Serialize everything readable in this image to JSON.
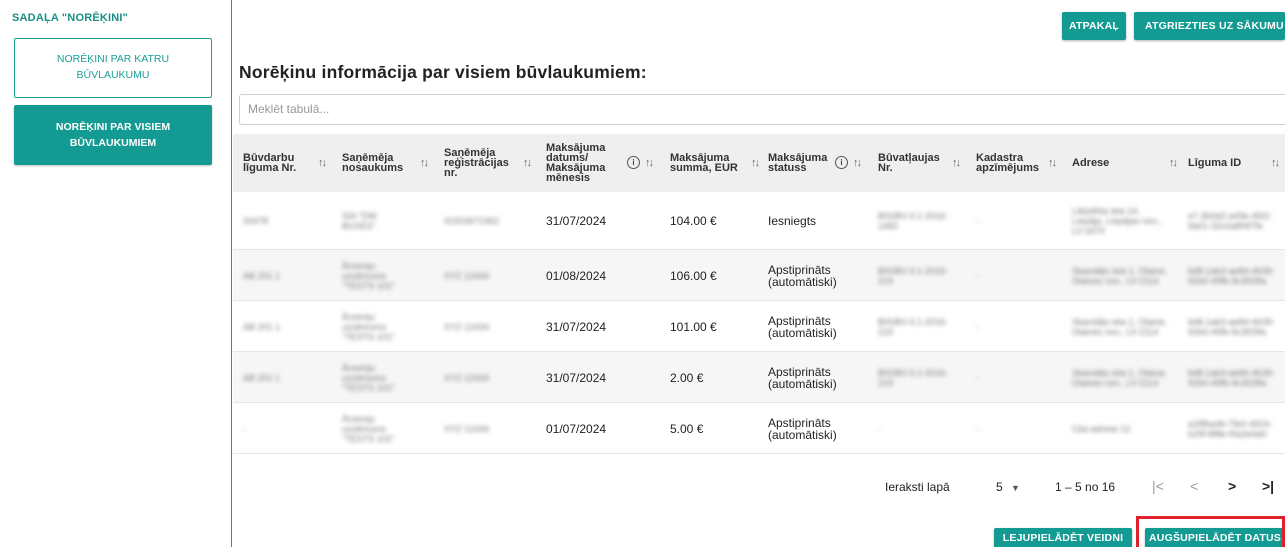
{
  "sidebar": {
    "title": "SADAĻA \"NORĒĶINI\"",
    "items": [
      {
        "label": "NORĒĶINI PAR KATRU BŪVLAUKUMU"
      },
      {
        "label": "NORĒĶINI PAR VISIEM BŪVLAUKUMIEM"
      }
    ]
  },
  "toolbar": {
    "back_label": "ATPAKAĻ",
    "start_label": "ATGRIEZTIES UZ SĀKUMU"
  },
  "main": {
    "title": "Norēķinu informācija par visiem būvlaukumiem:",
    "search_placeholder": "Meklēt tabulā..."
  },
  "table": {
    "headers": [
      "Būvdarbu līguma Nr.",
      "Saņēmēja nosaukums",
      "Saņēmēja reģistrācijas nr.",
      "Maksājuma datums/ Maksājuma mēnesis",
      "Maksājuma summa, EUR",
      "Maksājuma statuss",
      "Būvatļaujas Nr.",
      "Kadastra apzīmējums",
      "Adrese",
      "Līguma ID"
    ],
    "rows": [
      {
        "contract": "34478",
        "recipient": "SIA \"DW BUVES\"",
        "reg": "41503672362",
        "date": "31/07/2024",
        "amount": "104.00 €",
        "status": "Iesniegts",
        "permit": "BIS/BV-3.1-2016-1482",
        "cadastre": "-",
        "address": "Lāčplēša iela 14, Liepāja, Liepājas nov., LV-3470",
        "contract_id": "e7.3b0d2-a49e-45f2-9a01-32c0a8f4f7fe"
      },
      {
        "contract": "AB 201 1",
        "recipient": "Ārzemju uzņēmums \"TESTS 101\"",
        "reg": "XYZ 12434",
        "date": "01/08/2024",
        "amount": "106.00 €",
        "status": "Apstiprināts (automātiski)",
        "permit": "BIS/BV-3.1-2016-219",
        "cadastre": "-",
        "address": "Skandāļu iela 1, Olaine, Olaines nov., LV-2114",
        "contract_id": "6d8.1ab3-ae84-4639-92b0-49fb-9c3f29fa"
      },
      {
        "contract": "AB 201 1",
        "recipient": "Ārzemju uzņēmums \"TESTS 101\"",
        "reg": "XYZ 12434",
        "date": "31/07/2024",
        "amount": "101.00 €",
        "status": "Apstiprināts (automātiski)",
        "permit": "BIS/BV-3.1-2016-219",
        "cadastre": "-",
        "address": "Skandāļu iela 1, Olaine, Olaines nov., LV-2114",
        "contract_id": "6d8.1ab3-ae84-4639-92b0-49fb-9c3f29fa"
      },
      {
        "contract": "AB 201 1",
        "recipient": "Ārzemju uzņēmums \"TESTS 101\"",
        "reg": "XYZ 12434",
        "date": "31/07/2024",
        "amount": "2.00 €",
        "status": "Apstiprināts (automātiski)",
        "permit": "BIS/BV-3.1-2016-219",
        "cadastre": "-",
        "address": "Skandāļu iela 1, Olaine, Olaines nov., LV-2114",
        "contract_id": "6d8.1ab3-ae84-4639-92b0-49fb-9c3f29fa"
      },
      {
        "contract": "-",
        "recipient": "Ārzemju uzņēmums \"TESTS 101\"",
        "reg": "XYZ 12434",
        "date": "01/07/2024",
        "amount": "5.00 €",
        "status": "Apstiprināts (automātiski)",
        "permit": "-",
        "cadastre": "-",
        "address": "Cita adrese 12",
        "contract_id": "a1f8ba4b-7fe0-4924-b29f-8f8e-f0a2e9a0"
      }
    ]
  },
  "pagination": {
    "per_page_label": "Ieraksti lapā",
    "per_page_value": "5",
    "range": "1 – 5 no 16"
  },
  "bottom": {
    "download_label": "LEJUPIELĀDĒT VEIDNI",
    "upload_label": "AUGŠUPIELĀDĒT DATUS"
  },
  "colors": {
    "accent": "#139a92",
    "highlight": "#e0202a"
  }
}
